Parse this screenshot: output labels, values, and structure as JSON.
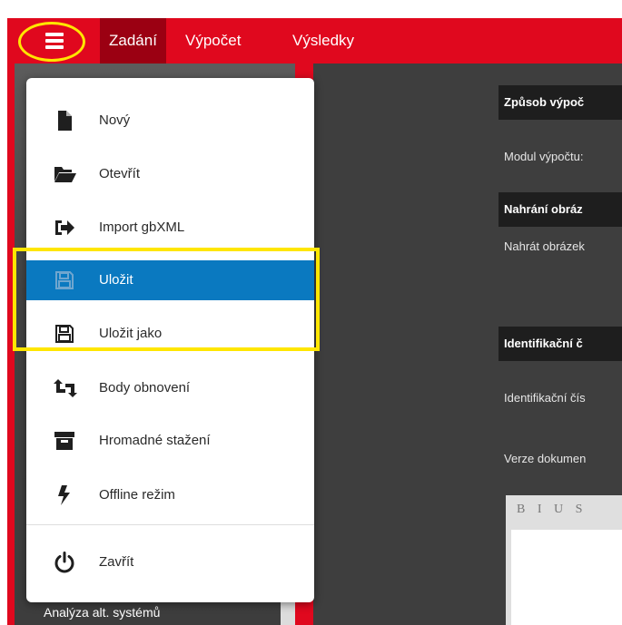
{
  "navbar": {
    "menu_icon": "hamburger-icon",
    "tabs": [
      {
        "label": "Zadání",
        "active": true
      },
      {
        "label": "Výpočet",
        "active": false
      },
      {
        "label": "Výsledky",
        "active": false
      }
    ]
  },
  "menu": {
    "items": [
      {
        "label": "Nový",
        "icon": "new-file-icon"
      },
      {
        "label": "Otevřít",
        "icon": "folder-open-icon"
      },
      {
        "label": "Import gbXML",
        "icon": "import-icon"
      },
      {
        "label": "Uložit",
        "icon": "save-icon",
        "selected": true
      },
      {
        "label": "Uložit jako",
        "icon": "save-as-icon"
      },
      {
        "label": "Body obnovení",
        "icon": "restore-points-icon"
      },
      {
        "label": "Hromadné stažení",
        "icon": "archive-icon"
      },
      {
        "label": "Offline režim",
        "icon": "bolt-icon"
      },
      {
        "label": "Zavřít",
        "icon": "power-icon"
      }
    ]
  },
  "sidebar": {
    "bottom_item": "Analýza alt. systémů"
  },
  "main": {
    "sections": [
      {
        "heading": "Způsob výpoč",
        "text": "Modul výpočtu:"
      },
      {
        "heading": "Nahrání obráz",
        "text": "Nahrát obrázek"
      },
      {
        "heading": "Identifikační č",
        "text": "Identifikační čís"
      }
    ],
    "extra_text": "Verze dokumen",
    "editor_tools": "B I U S"
  },
  "colors": {
    "brand_red": "#e0081e",
    "active_tab": "#9b0012",
    "selected_item": "#0a79c0",
    "highlight": "#ffe600"
  }
}
